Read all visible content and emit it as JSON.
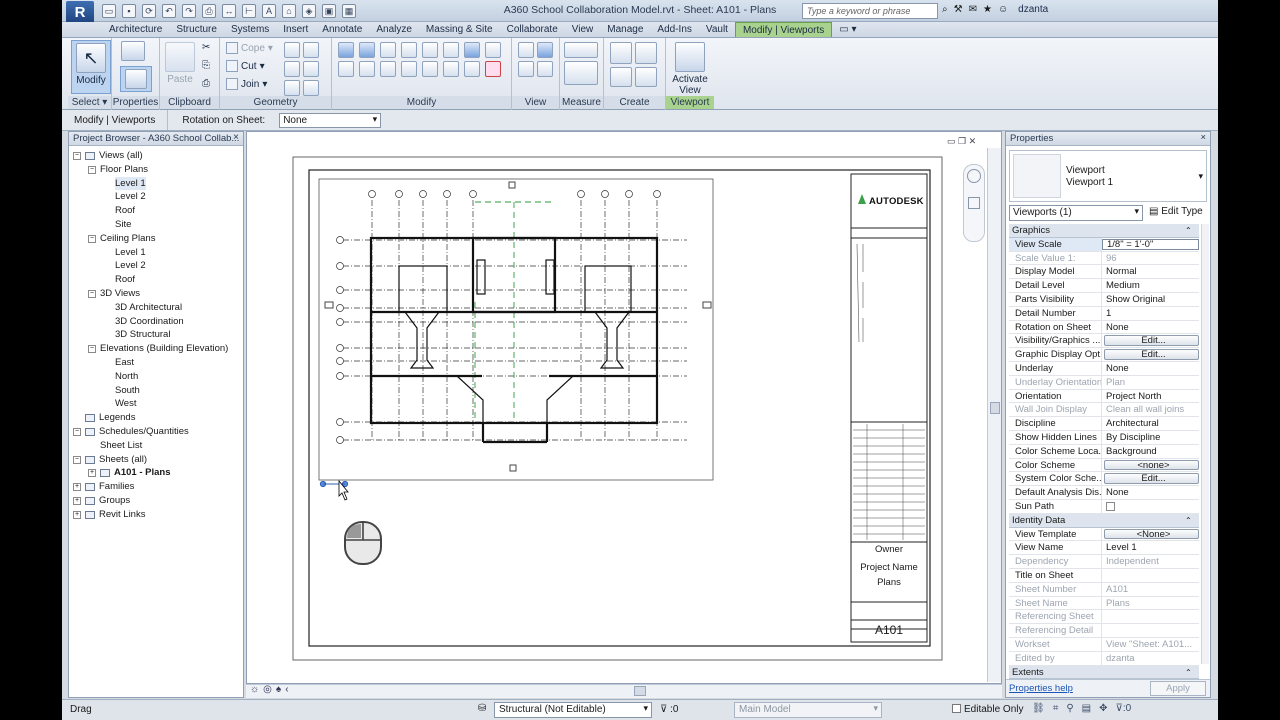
{
  "app": {
    "title": "A360 School Collaboration Model.rvt - Sheet: A101 - Plans",
    "logo": "R",
    "search_placeholder": "Type a keyword or phrase",
    "user": "dzanta"
  },
  "tabs": [
    "Architecture",
    "Structure",
    "Systems",
    "Insert",
    "Annotate",
    "Analyze",
    "Massing & Site",
    "Collaborate",
    "View",
    "Manage",
    "Add-Ins",
    "Vault",
    "Modify | Viewports"
  ],
  "ribbon": {
    "select": {
      "label": "Select",
      "btn": "Modify"
    },
    "properties": {
      "label": "Properties"
    },
    "clipboard": {
      "label": "Clipboard",
      "paste": "Paste",
      "cope": "Cope",
      "cut": "Cut",
      "join": "Join"
    },
    "geometry": {
      "label": "Geometry"
    },
    "modify": {
      "label": "Modify"
    },
    "view": {
      "label": "View"
    },
    "measure": {
      "label": "Measure"
    },
    "create": {
      "label": "Create"
    },
    "viewport": {
      "label": "Viewport",
      "activate": "Activate",
      "activate2": "View"
    }
  },
  "options_bar": {
    "context": "Modify | Viewports",
    "rotation_label": "Rotation on Sheet:",
    "rotation_value": "None"
  },
  "browser": {
    "title": "Project Browser - A360 School Collab...",
    "close": "×",
    "nodes": [
      {
        "label": "Views (all)",
        "level": 0,
        "exp": "−"
      },
      {
        "label": "Floor Plans",
        "level": 1,
        "exp": "−"
      },
      {
        "label": "Level 1",
        "level": 2,
        "selected": true
      },
      {
        "label": "Level 2",
        "level": 2
      },
      {
        "label": "Roof",
        "level": 2
      },
      {
        "label": "Site",
        "level": 2
      },
      {
        "label": "Ceiling Plans",
        "level": 1,
        "exp": "−"
      },
      {
        "label": "Level 1",
        "level": 2
      },
      {
        "label": "Level 2",
        "level": 2
      },
      {
        "label": "Roof",
        "level": 2
      },
      {
        "label": "3D Views",
        "level": 1,
        "exp": "−"
      },
      {
        "label": "3D Architectural",
        "level": 2
      },
      {
        "label": "3D Coordination",
        "level": 2
      },
      {
        "label": "3D Structural",
        "level": 2
      },
      {
        "label": "Elevations (Building Elevation)",
        "level": 1,
        "exp": "−"
      },
      {
        "label": "East",
        "level": 2
      },
      {
        "label": "North",
        "level": 2
      },
      {
        "label": "South",
        "level": 2
      },
      {
        "label": "West",
        "level": 2
      },
      {
        "label": "Legends",
        "level": 0
      },
      {
        "label": "Schedules/Quantities",
        "level": 0,
        "exp": "−"
      },
      {
        "label": "Sheet List",
        "level": 1
      },
      {
        "label": "Sheets (all)",
        "level": 0,
        "exp": "−"
      },
      {
        "label": "A101 - Plans",
        "level": 1,
        "exp": "+",
        "bold": true
      },
      {
        "label": "Families",
        "level": 0,
        "exp": "+"
      },
      {
        "label": "Groups",
        "level": 0,
        "exp": "+"
      },
      {
        "label": "Revit Links",
        "level": 0,
        "exp": "+"
      }
    ]
  },
  "sheet": {
    "brand": "AUTODESK",
    "owner": "Owner",
    "project": "Project Name",
    "sheet_name": "Plans",
    "sheet_number": "A101"
  },
  "properties": {
    "title": "Properties",
    "close": "×",
    "type_line1": "Viewport",
    "type_line2": "Viewport 1",
    "instance": "Viewports (1)",
    "edit_type": "Edit Type",
    "rows": [
      {
        "group": "Graphics"
      },
      {
        "k": "View Scale",
        "v": "1/8\" = 1'-0\"",
        "box": true
      },
      {
        "k": "Scale Value    1:",
        "v": "96",
        "ro": true
      },
      {
        "k": "Display Model",
        "v": "Normal"
      },
      {
        "k": "Detail Level",
        "v": "Medium"
      },
      {
        "k": "Parts Visibility",
        "v": "Show Original"
      },
      {
        "k": "Detail Number",
        "v": "1"
      },
      {
        "k": "Rotation on Sheet",
        "v": "None"
      },
      {
        "k": "Visibility/Graphics ...",
        "v": "Edit...",
        "btn": true
      },
      {
        "k": "Graphic Display Opt...",
        "v": "Edit...",
        "btn": true
      },
      {
        "k": "Underlay",
        "v": "None"
      },
      {
        "k": "Underlay Orientation",
        "v": "Plan",
        "ro": true
      },
      {
        "k": "Orientation",
        "v": "Project North"
      },
      {
        "k": "Wall Join Display",
        "v": "Clean all wall joins",
        "ro": true
      },
      {
        "k": "Discipline",
        "v": "Architectural"
      },
      {
        "k": "Show Hidden Lines",
        "v": "By Discipline"
      },
      {
        "k": "Color Scheme Loca...",
        "v": "Background"
      },
      {
        "k": "Color Scheme",
        "v": "<none>",
        "btn": true
      },
      {
        "k": "System Color Sche...",
        "v": "Edit...",
        "btn": true
      },
      {
        "k": "Default Analysis Dis...",
        "v": "None"
      },
      {
        "k": "Sun Path",
        "v": "",
        "check": true
      },
      {
        "group": "Identity Data"
      },
      {
        "k": "View Template",
        "v": "<None>",
        "btn": true
      },
      {
        "k": "View Name",
        "v": "Level 1"
      },
      {
        "k": "Dependency",
        "v": "Independent",
        "ro": true
      },
      {
        "k": "Title on Sheet",
        "v": ""
      },
      {
        "k": "Sheet Number",
        "v": "A101",
        "ro": true
      },
      {
        "k": "Sheet Name",
        "v": "Plans",
        "ro": true
      },
      {
        "k": "Referencing Sheet",
        "v": "",
        "ro": true
      },
      {
        "k": "Referencing Detail",
        "v": "",
        "ro": true
      },
      {
        "k": "Workset",
        "v": "View \"Sheet: A101...",
        "ro": true
      },
      {
        "k": "Edited by",
        "v": "dzanta",
        "ro": true
      },
      {
        "group": "Extents"
      }
    ],
    "help": "Properties help",
    "apply": "Apply"
  },
  "status": {
    "text": "Drag",
    "workset": "Structural (Not Editable)",
    "count": ":0",
    "model": "Main Model",
    "editable_only": "Editable Only"
  },
  "colors": {
    "active_tab": "#a8d28e",
    "autodesk_green": "#3aa04a"
  }
}
